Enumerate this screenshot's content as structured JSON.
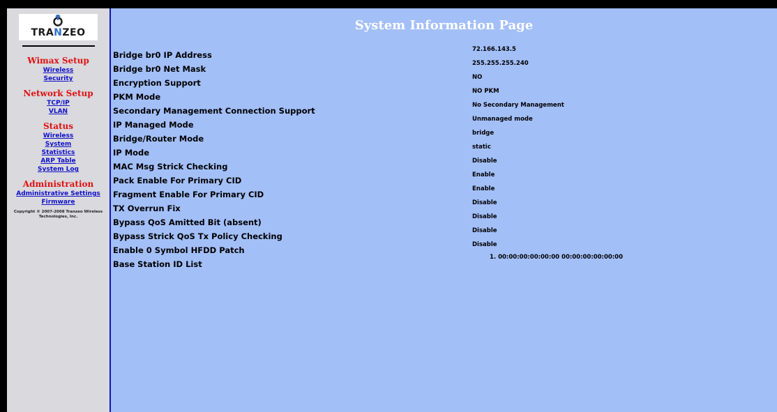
{
  "logo": {
    "text_pre": "TRA",
    "text_n": "N",
    "text_post": "ZEO"
  },
  "nav": {
    "sections": [
      {
        "title": "Wimax Setup",
        "links": [
          "Wireless",
          "Security"
        ]
      },
      {
        "title": "Network Setup",
        "links": [
          "TCP/IP",
          "VLAN"
        ]
      },
      {
        "title": "Status",
        "links": [
          "Wireless",
          "System",
          "Statistics",
          "ARP Table",
          "System Log"
        ]
      },
      {
        "title": "Administration",
        "links": [
          "Administrative Settings",
          "Firmware"
        ]
      }
    ],
    "copyright": "Copyright © 2007-2008 Tranzeo Wireless Technologies, Inc."
  },
  "page": {
    "title": "System Information Page"
  },
  "info": {
    "rows": [
      {
        "label": "Bridge br0 IP Address",
        "value": "72.166.143.5"
      },
      {
        "label": "Bridge br0 Net Mask",
        "value": "255.255.255.240"
      },
      {
        "label": "Encryption Support",
        "value": "NO"
      },
      {
        "label": "PKM Mode",
        "value": "NO PKM"
      },
      {
        "label": "Secondary Management Connection Support",
        "value": "No Secondary Management"
      },
      {
        "label": "IP Managed Mode",
        "value": "Unmanaged mode"
      },
      {
        "label": "Bridge/Router Mode",
        "value": "bridge"
      },
      {
        "label": "IP Mode",
        "value": "static"
      },
      {
        "label": "MAC Msg Strick Checking",
        "value": "Disable"
      },
      {
        "label": "Pack Enable For Primary CID",
        "value": "Enable"
      },
      {
        "label": "Fragment Enable For Primary CID",
        "value": "Enable"
      },
      {
        "label": "TX Overrun Fix",
        "value": "Disable"
      },
      {
        "label": "Bypass QoS Amitted Bit (absent)",
        "value": "Disable"
      },
      {
        "label": "Bypass Strick QoS Tx Policy Checking",
        "value": "Disable"
      },
      {
        "label": "Enable 0 Symbol HFDD Patch",
        "value": "Disable"
      },
      {
        "label": "Base Station ID List",
        "value": "1.  00:00:00:00:00:00 00:00:00:00:00:00"
      }
    ]
  },
  "colors": {
    "sidebar_bg": "#d9d9de",
    "main_bg": "#a3bff8",
    "section_red": "#e01010",
    "link_blue": "#1010c8",
    "divider_blue": "#1414b4"
  }
}
